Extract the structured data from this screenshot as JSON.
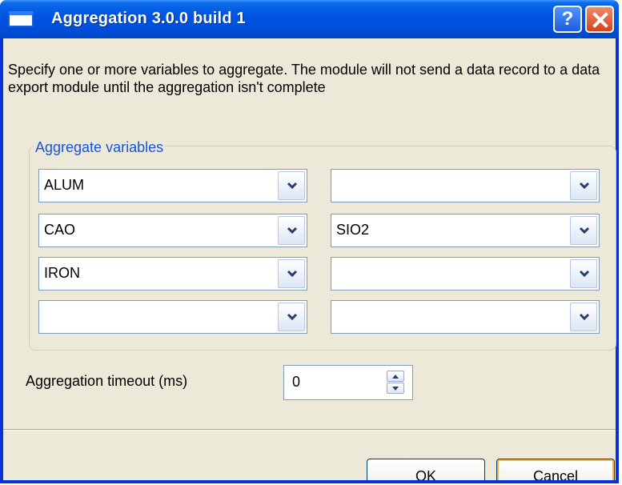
{
  "window": {
    "title": "Aggregation 3.0.0 build 1",
    "help_label": "?"
  },
  "description": "Specify one or more variables to aggregate. The module will not send a data record to a data export module until the aggregation isn't complete",
  "aggregate_group": {
    "label": "Aggregate variables",
    "variables": [
      "ALUM",
      "",
      "CAO",
      "SIO2",
      "IRON",
      "",
      "",
      ""
    ]
  },
  "timeout": {
    "label": "Aggregation timeout (ms)",
    "value": "0"
  },
  "buttons": {
    "ok": "OK",
    "cancel": "Cancel"
  },
  "colors": {
    "title_bar": "#0054e3",
    "client_background": "#ece9d8",
    "group_label": "#1454e6",
    "close_button": "#d4431d"
  }
}
